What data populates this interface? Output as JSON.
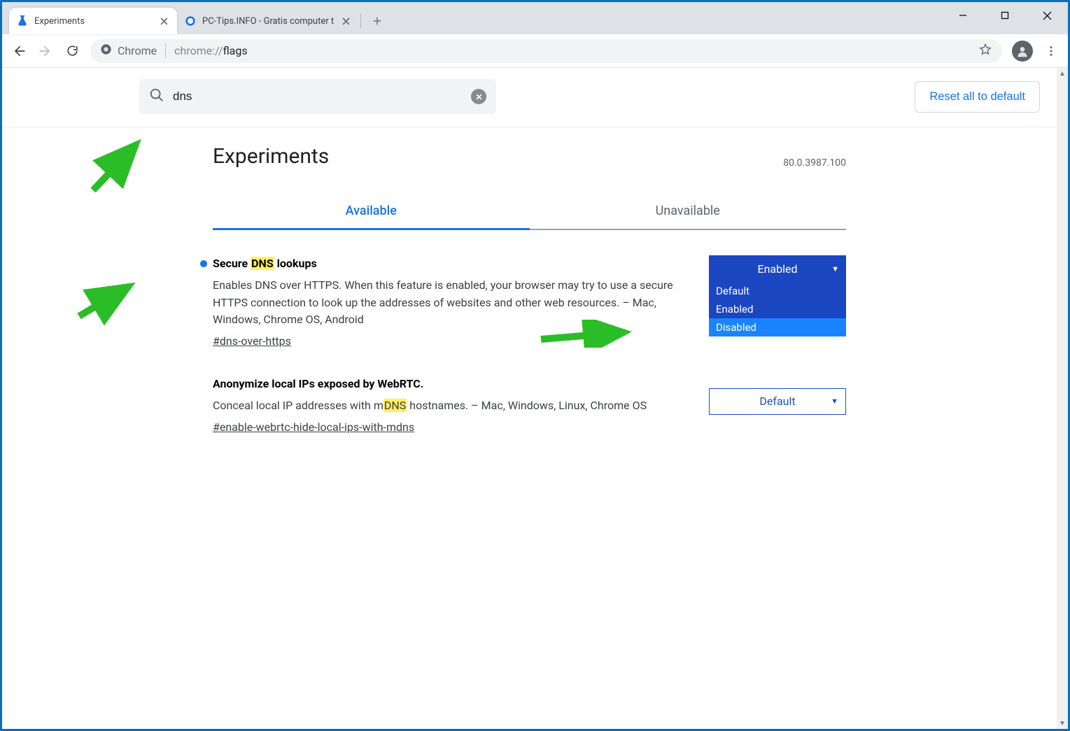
{
  "window": {
    "tabs": [
      {
        "title": "Experiments",
        "active": true,
        "favicon": "flask"
      },
      {
        "title": "PC-Tips.INFO - Gratis computer t",
        "active": false,
        "favicon": "pctips"
      }
    ]
  },
  "address_bar": {
    "chip_label": "Chrome",
    "url_prefix": "chrome://",
    "url_fragment": "flags"
  },
  "flags_page": {
    "search_value": "dns",
    "reset_button": "Reset all to default",
    "title": "Experiments",
    "version": "80.0.3987.100",
    "tabs": {
      "available": "Available",
      "unavailable": "Unavailable"
    },
    "dropdown_options": [
      "Default",
      "Enabled",
      "Disabled"
    ],
    "flags": [
      {
        "marked": true,
        "title_pre": "Secure ",
        "title_hl": "DNS",
        "title_post": " lookups",
        "desc": "Enables DNS over HTTPS. When this feature is enabled, your browser may try to use a secure HTTPS connection to look up the addresses of websites and other web resources. – Mac, Windows, Chrome OS, Android",
        "hash": "#dns-over-https",
        "select_value": "Enabled",
        "select_style": "enabled",
        "dropdown_open": true,
        "dropdown_highlight": "Disabled"
      },
      {
        "marked": false,
        "title_pre": "Anonymize local IPs exposed by WebRTC.",
        "title_hl": "",
        "title_post": "",
        "desc_pre": "Conceal local IP addresses with m",
        "desc_hl": "DNS",
        "desc_post": " hostnames. – Mac, Windows, Linux, Chrome OS",
        "hash": "#enable-webrtc-hide-local-ips-with-mdns",
        "select_value": "Default",
        "select_style": "default",
        "dropdown_open": false
      }
    ]
  }
}
